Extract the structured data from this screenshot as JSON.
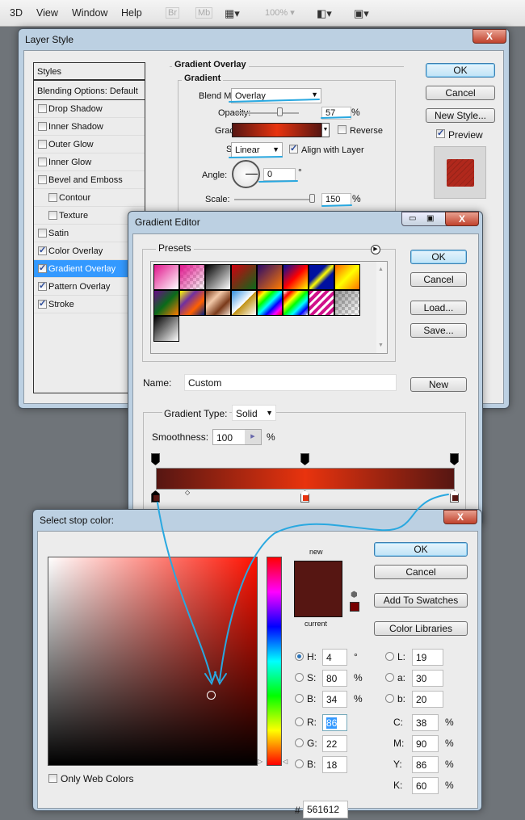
{
  "menubar": {
    "items": [
      "3D",
      "View",
      "Window",
      "Help"
    ],
    "bridge": "Br",
    "minibridge": "Mb",
    "zoom": "100%"
  },
  "layer_style": {
    "title": "Layer Style",
    "close": "X",
    "styles_header": "Styles",
    "blending_options": "Blending Options: Default",
    "effects": [
      {
        "label": "Drop Shadow",
        "checked": false,
        "indent": false,
        "selected": false
      },
      {
        "label": "Inner Shadow",
        "checked": false,
        "indent": false,
        "selected": false
      },
      {
        "label": "Outer Glow",
        "checked": false,
        "indent": false,
        "selected": false
      },
      {
        "label": "Inner Glow",
        "checked": false,
        "indent": false,
        "selected": false
      },
      {
        "label": "Bevel and Emboss",
        "checked": false,
        "indent": false,
        "selected": false
      },
      {
        "label": "Contour",
        "checked": false,
        "indent": true,
        "selected": false
      },
      {
        "label": "Texture",
        "checked": false,
        "indent": true,
        "selected": false
      },
      {
        "label": "Satin",
        "checked": false,
        "indent": false,
        "selected": false
      },
      {
        "label": "Color Overlay",
        "checked": true,
        "indent": false,
        "selected": false
      },
      {
        "label": "Gradient Overlay",
        "checked": true,
        "indent": false,
        "selected": true
      },
      {
        "label": "Pattern Overlay",
        "checked": true,
        "indent": false,
        "selected": false
      },
      {
        "label": "Stroke",
        "checked": true,
        "indent": false,
        "selected": false
      }
    ],
    "section_title": "Gradient Overlay",
    "group_title": "Gradient",
    "blend_mode_label": "Blend Mode:",
    "blend_mode": "Overlay",
    "opacity_label": "Opacity:",
    "opacity": "57",
    "opacity_unit": "%",
    "gradient_label": "Gradient:",
    "reverse_label": "Reverse",
    "reverse": false,
    "style_label": "Style:",
    "style": "Linear",
    "align_label": "Align with Layer",
    "align": true,
    "angle_label": "Angle:",
    "angle": "0",
    "angle_unit": "°",
    "scale_label": "Scale:",
    "scale": "150",
    "scale_unit": "%",
    "ok": "OK",
    "cancel": "Cancel",
    "new_style": "New Style...",
    "preview_label": "Preview",
    "preview": true,
    "preview_color": "#b0281c"
  },
  "gradient_editor": {
    "title": "Gradient Editor",
    "presets_label": "Presets",
    "ok": "OK",
    "cancel": "Cancel",
    "load": "Load...",
    "save": "Save...",
    "new": "New",
    "name_label": "Name:",
    "name": "Custom",
    "type_label": "Gradient Type:",
    "type": "Solid",
    "smoothness_label": "Smoothness:",
    "smoothness": "100",
    "smoothness_unit": "%",
    "gradient_colors": [
      "#561612",
      "#e8330e",
      "#561612"
    ],
    "color_stops": [
      {
        "location": 0,
        "color": "#561612"
      },
      {
        "location": 50,
        "color": "#e8330e"
      },
      {
        "location": 100,
        "color": "#561612"
      }
    ],
    "opacity_stops": [
      0,
      50,
      100
    ]
  },
  "color_picker": {
    "title": "Select stop color:",
    "close": "X",
    "new_label": "new",
    "current_label": "current",
    "new_color": "#561612",
    "current_color": "#561612",
    "ok": "OK",
    "cancel": "Cancel",
    "add_swatches": "Add To Swatches",
    "color_libraries": "Color Libraries",
    "only_web_label": "Only Web Colors",
    "only_web": false,
    "fields": {
      "H": {
        "label": "H:",
        "value": "4",
        "unit": "°"
      },
      "S": {
        "label": "S:",
        "value": "80",
        "unit": "%"
      },
      "Bv": {
        "label": "B:",
        "value": "34",
        "unit": "%"
      },
      "R": {
        "label": "R:",
        "value": "86"
      },
      "G": {
        "label": "G:",
        "value": "22"
      },
      "Bc": {
        "label": "B:",
        "value": "18"
      },
      "L": {
        "label": "L:",
        "value": "19"
      },
      "a": {
        "label": "a:",
        "value": "30"
      },
      "b": {
        "label": "b:",
        "value": "20"
      },
      "C": {
        "label": "C:",
        "value": "38",
        "unit": "%"
      },
      "M": {
        "label": "M:",
        "value": "90",
        "unit": "%"
      },
      "Y": {
        "label": "Y:",
        "value": "86",
        "unit": "%"
      },
      "K": {
        "label": "K:",
        "value": "60",
        "unit": "%"
      }
    },
    "hash_label": "#",
    "hex": "561612"
  },
  "colors": {
    "annotation": "#29a8e0",
    "selection": "#3399ff"
  }
}
